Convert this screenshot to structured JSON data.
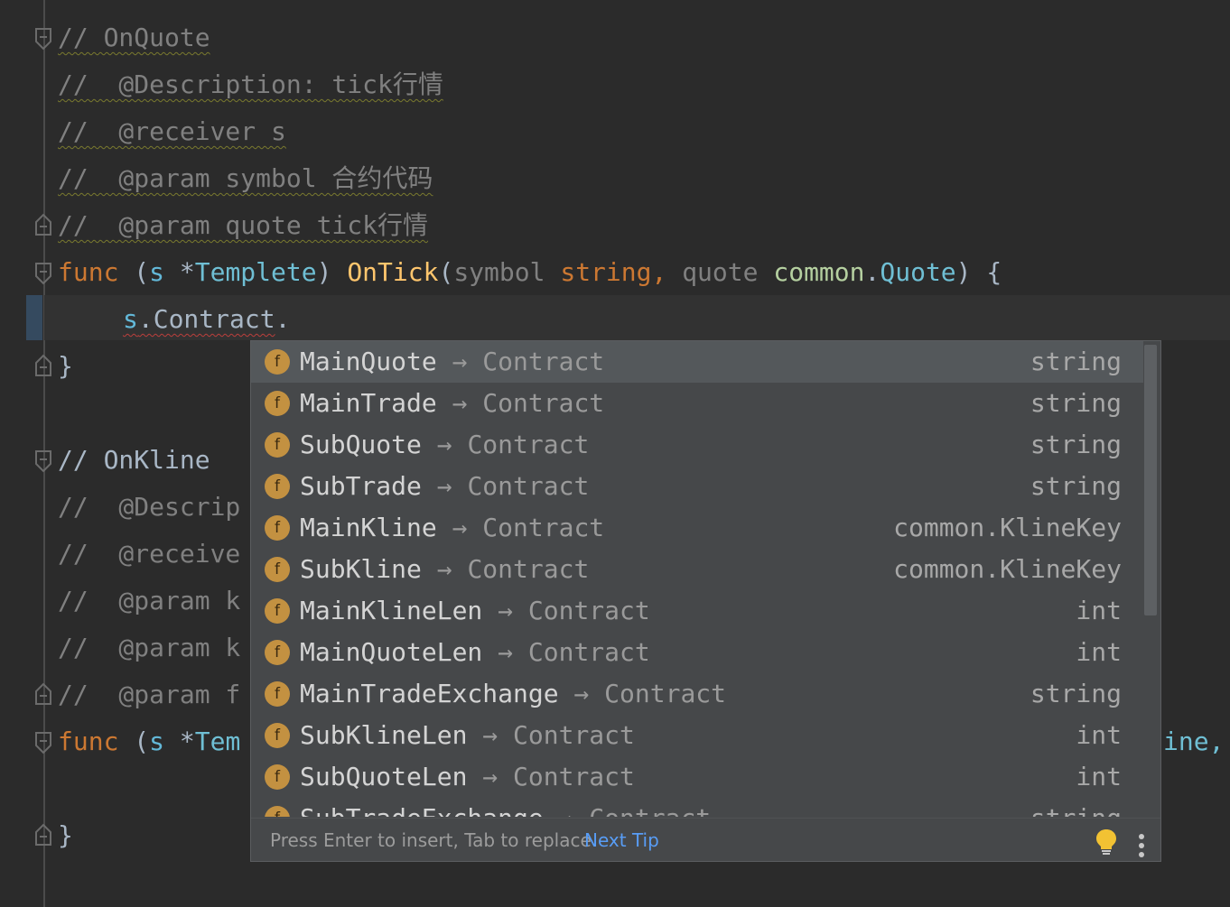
{
  "code": {
    "lines": [
      {
        "kind": "comment",
        "text": "// OnQuote"
      },
      {
        "kind": "comment",
        "text": "//  @Description: tick行情"
      },
      {
        "kind": "comment",
        "text": "//  @receiver s"
      },
      {
        "kind": "comment",
        "text": "//  @param symbol 合约代码"
      },
      {
        "kind": "comment",
        "text": "//  @param quote tick行情"
      }
    ],
    "func1": {
      "kw": "func",
      "open": " (",
      "recv": "s",
      "star": " *",
      "type": "Templete",
      "close": ") ",
      "name": "OnTick",
      "p1": "(",
      "arg1": "symbol",
      "t1": " string,",
      "arg2": " quote",
      "pkg": " common",
      "dot": ".",
      "t2": "Quote",
      "end": ") {"
    },
    "current_line": {
      "recv": "s",
      "member": ".Contract",
      "dot": "."
    },
    "close1": "}",
    "comments2": [
      {
        "text": "// OnKline"
      },
      {
        "text": "//  @Descrip"
      },
      {
        "text": "//  @receive"
      },
      {
        "text": "//  @param k"
      },
      {
        "text": "//  @param k"
      },
      {
        "text": "//  @param f"
      }
    ],
    "func2": {
      "kw": "func",
      "open": " (",
      "recv": "s",
      "star": " *",
      "type": "Tem"
    },
    "func2_tail": "ine,",
    "close2": "}"
  },
  "completion": {
    "items": [
      {
        "badge": "f",
        "name": "MainQuote",
        "arrow": " → ",
        "owner": "Contract",
        "type": "string"
      },
      {
        "badge": "f",
        "name": "MainTrade",
        "arrow": " → ",
        "owner": "Contract",
        "type": "string"
      },
      {
        "badge": "f",
        "name": "SubQuote",
        "arrow": " → ",
        "owner": "Contract",
        "type": "string"
      },
      {
        "badge": "f",
        "name": "SubTrade",
        "arrow": " → ",
        "owner": "Contract",
        "type": "string"
      },
      {
        "badge": "f",
        "name": "MainKline",
        "arrow": " → ",
        "owner": "Contract",
        "type": "common.KlineKey"
      },
      {
        "badge": "f",
        "name": "SubKline",
        "arrow": " → ",
        "owner": "Contract",
        "type": "common.KlineKey"
      },
      {
        "badge": "f",
        "name": "MainKlineLen",
        "arrow": " → ",
        "owner": "Contract",
        "type": "int"
      },
      {
        "badge": "f",
        "name": "MainQuoteLen",
        "arrow": " → ",
        "owner": "Contract",
        "type": "int"
      },
      {
        "badge": "f",
        "name": "MainTradeExchange",
        "arrow": " → ",
        "owner": "Contract",
        "type": "string"
      },
      {
        "badge": "f",
        "name": "SubKlineLen",
        "arrow": " → ",
        "owner": "Contract",
        "type": "int"
      },
      {
        "badge": "f",
        "name": "SubQuoteLen",
        "arrow": " → ",
        "owner": "Contract",
        "type": "int"
      },
      {
        "badge": "f",
        "name": "SubTradeExchange",
        "arrow": " → ",
        "owner": "Contract",
        "type": "string"
      }
    ],
    "selected_index": 0,
    "footer_hint": "Press Enter to insert, Tab to replace",
    "next_tip": "Next Tip",
    "bulb_icon": "lightbulb-icon",
    "menu_icon": "more-vertical-icon",
    "badge_color": "#c39141",
    "link_color": "#589df6"
  }
}
